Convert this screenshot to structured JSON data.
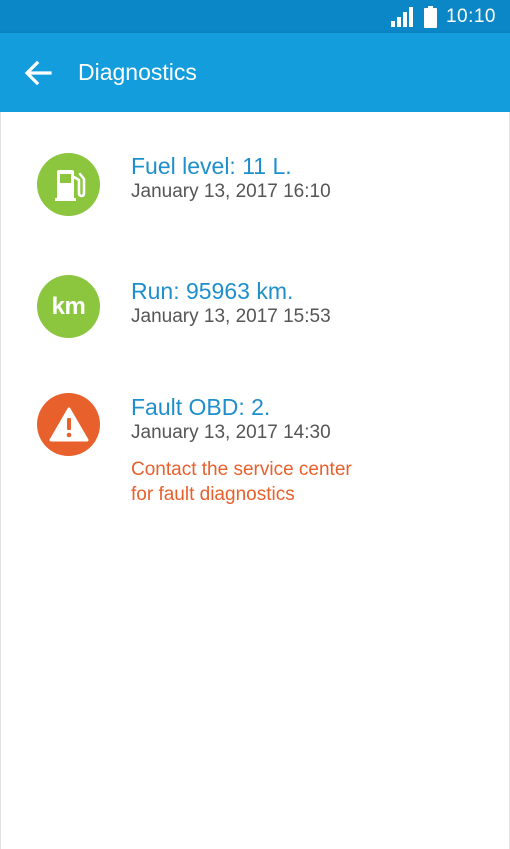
{
  "status_bar": {
    "time": "10:10",
    "icons": [
      "signal-icon",
      "battery-icon"
    ]
  },
  "app_bar": {
    "title": "Diagnostics",
    "back_icon": "arrow-left-icon"
  },
  "colors": {
    "status_bar": "#0b86c6",
    "app_bar": "#139ddd",
    "title_text": "#1f8fcc",
    "ok_icon": "#8cc63f",
    "warning_icon": "#e8602c",
    "warning_text": "#e8602c"
  },
  "items": [
    {
      "icon": "fuel-pump-icon",
      "title": "Fuel level: 11 L.",
      "date": "January 13, 2017 16:10"
    },
    {
      "icon": "km-icon",
      "icon_text": "km",
      "title": "Run: 95963 km.",
      "date": "January 13, 2017 15:53"
    },
    {
      "icon": "warning-icon",
      "title": "Fault OBD: 2.",
      "date": "January 13, 2017 14:30",
      "warning_line1": "Contact the service center",
      "warning_line2": "for fault diagnostics"
    }
  ]
}
